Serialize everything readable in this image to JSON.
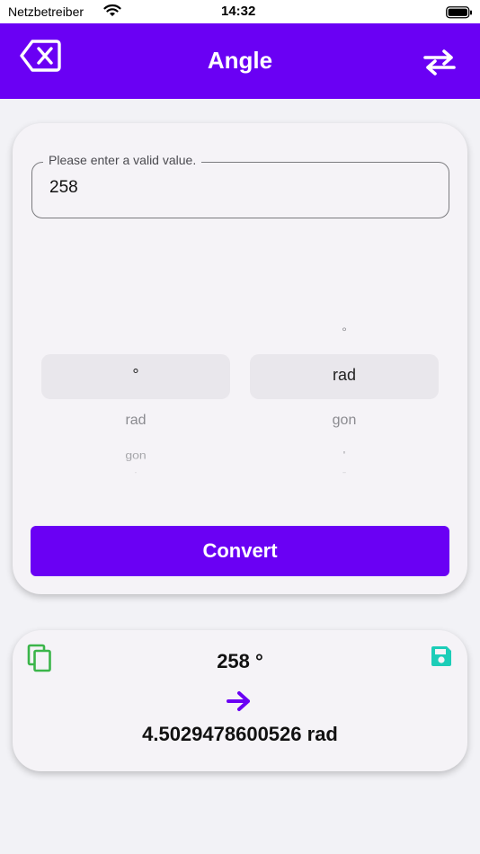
{
  "status_bar": {
    "carrier": "Netzbetreiber",
    "time": "14:32"
  },
  "app_bar": {
    "title": "Angle",
    "back_icon": "backspace-x-icon",
    "swap_icon": "swap-arrows-icon"
  },
  "input": {
    "label": "Please enter a valid value.",
    "value": "258"
  },
  "from_picker": {
    "selected": "°",
    "next": [
      "rad",
      "gon",
      "'"
    ]
  },
  "to_picker": {
    "previous": [
      "°"
    ],
    "selected": "rad",
    "next": [
      "gon",
      "'",
      "''"
    ]
  },
  "convert_button": {
    "label": "Convert"
  },
  "result": {
    "from": "258 °",
    "to": "4.5029478600526 rad",
    "copy_icon": "copy-icon",
    "save_icon": "floppy-save-icon",
    "arrow_icon": "arrow-right-icon"
  },
  "colors": {
    "primary": "#6a00f4",
    "copy_green": "#3bb54a",
    "save_teal": "#1ccdb8",
    "card_bg": "#f5f3f7",
    "page_bg": "#f2f2f6"
  }
}
